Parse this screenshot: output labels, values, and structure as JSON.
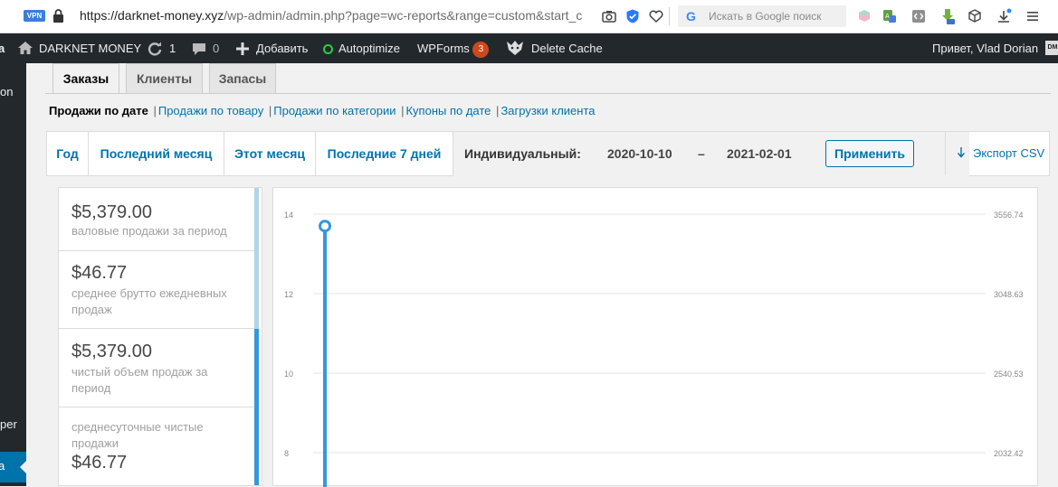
{
  "browser": {
    "vpn_label": "VPN",
    "url_host": "https://darknet-money.xyz",
    "url_path": "/wp-admin/admin.php?page=wc-reports&range=custom&start_c",
    "search_placeholder": "Искать в Google поиск",
    "search_logo": "G"
  },
  "admin_bar": {
    "site_name": "DARKNET MONEY",
    "updates_count": "1",
    "comments_count": "0",
    "add_label": "Добавить",
    "autoptimize_label": "Autoptimize",
    "wpforms_label": "WPForms",
    "wpforms_badge": "3",
    "delete_cache_label": "Delete Cache",
    "greeting": "Привет, Vlad Dorian",
    "avatar_initials": "DM"
  },
  "sidebar": {
    "partial_label_1": "on",
    "partial_label_2": "per"
  },
  "tabs": [
    {
      "label": "Заказы",
      "active": true
    },
    {
      "label": "Клиенты",
      "active": false
    },
    {
      "label": "Запасы",
      "active": false
    }
  ],
  "subnav": {
    "current": "Продажи по дате",
    "links": [
      "Продажи по товару",
      "Продажи по категории",
      "Купоны по дате",
      "Загрузки клиента"
    ]
  },
  "range": {
    "items": [
      "Год",
      "Последний месяц",
      "Этот месяц",
      "Последние 7 дней"
    ],
    "custom_label": "Индивидуальный:",
    "start_date": "2020-10-10",
    "dash": "–",
    "end_date": "2021-02-01",
    "apply_label": "Применить",
    "export_label": "Экспорт CSV"
  },
  "legend": [
    {
      "amount": "$5,379.00",
      "desc": "валовые продажи за период",
      "color": "#b1d4ea"
    },
    {
      "amount": "$46.77",
      "desc": "среднее брутто ежедневных продаж",
      "color": "#b1d4ea"
    },
    {
      "amount": "$5,379.00",
      "desc": "чистый объем продаж за период",
      "color": "#3498db"
    },
    {
      "amount": "$46.77",
      "desc": "среднесуточные чистые продажи",
      "color": "#3498db"
    }
  ],
  "chart_data": {
    "type": "line",
    "y_left_ticks": [
      "14",
      "12",
      "10",
      "8"
    ],
    "y_right_ticks": [
      "3556.74",
      "3048.63",
      "2540.53",
      "2032.42"
    ],
    "series": [
      {
        "values": [
          {
            "x_index": 0,
            "y": 13.7
          }
        ],
        "color": "#3498db"
      }
    ],
    "grid": true
  },
  "colors": {
    "wp_blue": "#0073aa",
    "admin_bar_bg": "#23282d",
    "chart_line": "#3498db"
  }
}
